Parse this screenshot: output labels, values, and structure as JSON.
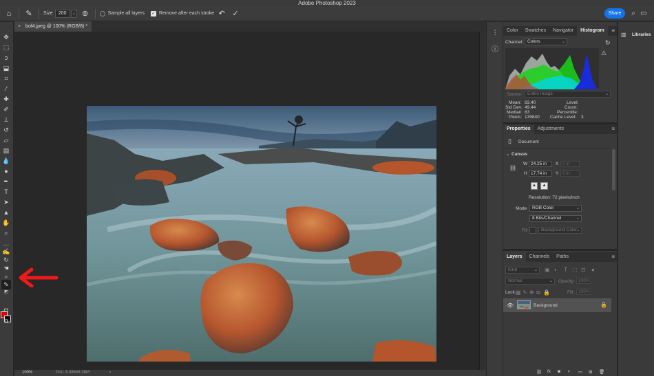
{
  "app": {
    "title": "Adobe Photoshop 2023"
  },
  "options_bar": {
    "size_label": "Size",
    "size_value": "200",
    "sample_all_layers": "Sample all layers",
    "remove_after_stroke": "Remove after each stroke",
    "share_label": "Share"
  },
  "document": {
    "tab_title": "bof4.jpeg @ 100% (RGB/8) *",
    "close_glyph": "×"
  },
  "status": {
    "zoom": "100%",
    "doc_info": "Doc: 8.38M/8.38M",
    "arrow": "›"
  },
  "colors": {
    "foreground": "#e00000",
    "background": "#111111",
    "share": "#1473e6"
  },
  "histogram_panel": {
    "tabs": [
      "Color",
      "Swatches",
      "Navigator",
      "Histogram"
    ],
    "active_tab": "Histogram",
    "channel_label": "Channel:",
    "channel_value": "Colors",
    "source_label": "Source:",
    "source_value": "Entire Image",
    "stats_left": [
      {
        "label": "Mean:",
        "value": "93.40"
      },
      {
        "label": "Std Dev:",
        "value": "49.44"
      },
      {
        "label": "Median:",
        "value": "83"
      },
      {
        "label": "Pixels:",
        "value": "139840"
      }
    ],
    "stats_right": [
      {
        "label": "Level:",
        "value": ""
      },
      {
        "label": "Count:",
        "value": ""
      },
      {
        "label": "Percentile:",
        "value": ""
      },
      {
        "label": "Cache Level:",
        "value": "3"
      }
    ]
  },
  "properties_panel": {
    "tabs": [
      "Properties",
      "Adjustments"
    ],
    "active_tab": "Properties",
    "section_document": "Document",
    "section_canvas": "Canvas",
    "w_label": "W",
    "w_value": "24.25 in",
    "h_label": "H",
    "h_value": "17.74 in",
    "x_label": "X",
    "x_value": "0 in",
    "y_label": "Y",
    "y_value": "0 in",
    "resolution": "Resolution: 72 pixels/inch",
    "mode_label": "Mode",
    "mode_value": "RGB Color",
    "depth_value": "8 Bits/Channel",
    "fill_label": "Fill",
    "fill_value": "Background Color"
  },
  "layers_panel": {
    "tabs": [
      "Layers",
      "Channels",
      "Paths"
    ],
    "active_tab": "Layers",
    "kind_placeholder": "Kind",
    "blend_mode": "Normal",
    "opacity_label": "Opacity:",
    "opacity_value": "100%",
    "lock_label": "Lock:",
    "fill_label": "Fill:",
    "fill_value": "100%",
    "layer_name": "Background"
  },
  "libraries": {
    "title": "Libraries"
  }
}
